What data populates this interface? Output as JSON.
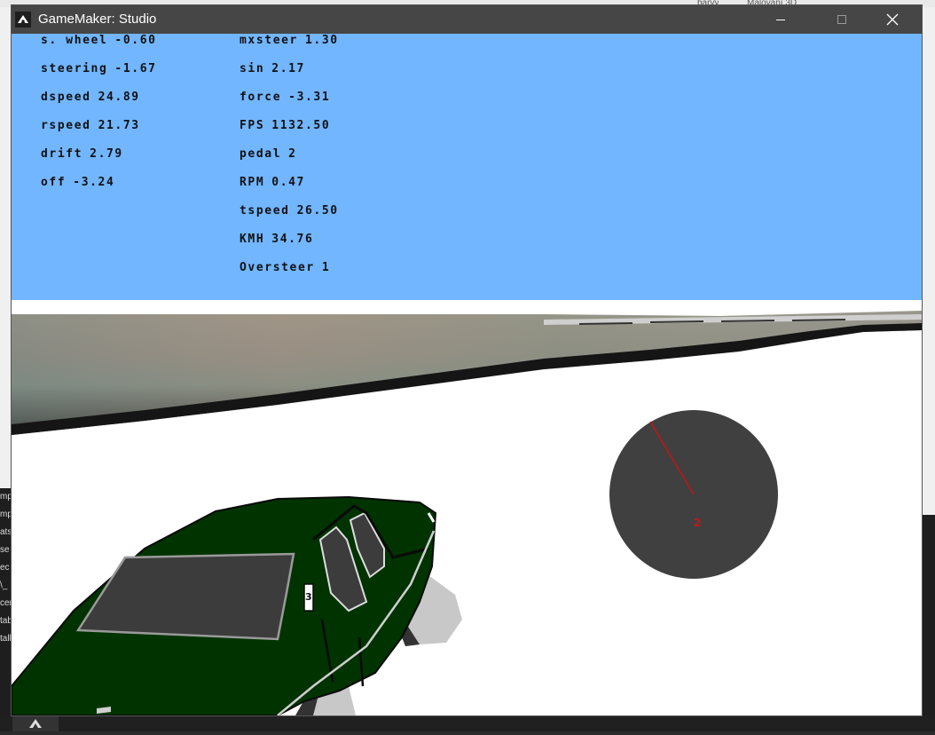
{
  "desktop": {
    "top_chips": [
      "barvy",
      "Malování 3D"
    ],
    "left_fragments": [
      "mp",
      "mp",
      "ats",
      "se",
      "ec",
      "\\_",
      "cen",
      "tab",
      "tall"
    ]
  },
  "window": {
    "title": "GameMaker: Studio",
    "colors": {
      "titlebar": "#464646",
      "sky": "#72b6ff",
      "ground": "#ffffff",
      "car_body": "#003300",
      "gauge": "#404040",
      "needle": "#cc1010"
    }
  },
  "hud": {
    "left": [
      {
        "label": "s. wheel",
        "value": "-0.60"
      },
      {
        "label": "steering",
        "value": "-1.67"
      },
      {
        "label": "dspeed",
        "value": "24.89"
      },
      {
        "label": "rspeed",
        "value": "21.73"
      },
      {
        "label": "drift",
        "value": "2.79"
      },
      {
        "label": "off",
        "value": "-3.24"
      }
    ],
    "right": [
      {
        "label": "mxsteer",
        "value": "1.30"
      },
      {
        "label": "sin",
        "value": "2.17"
      },
      {
        "label": "force",
        "value": "-3.31"
      },
      {
        "label": "FPS",
        "value": "1132.50"
      },
      {
        "label": "pedal",
        "value": "2"
      },
      {
        "label": "RPM",
        "value": "0.47"
      },
      {
        "label": "tspeed",
        "value": "26.50"
      },
      {
        "label": "KMH",
        "value": "34.76"
      },
      {
        "label": "Oversteer",
        "value": "1"
      }
    ]
  },
  "gauge": {
    "gear": "2",
    "icon": "tachometer-icon"
  },
  "car": {
    "plate": "3"
  },
  "icons": {
    "app": "gamemaker-icon",
    "minimize": "minimize-icon",
    "maximize": "maximize-icon",
    "close": "close-icon"
  }
}
